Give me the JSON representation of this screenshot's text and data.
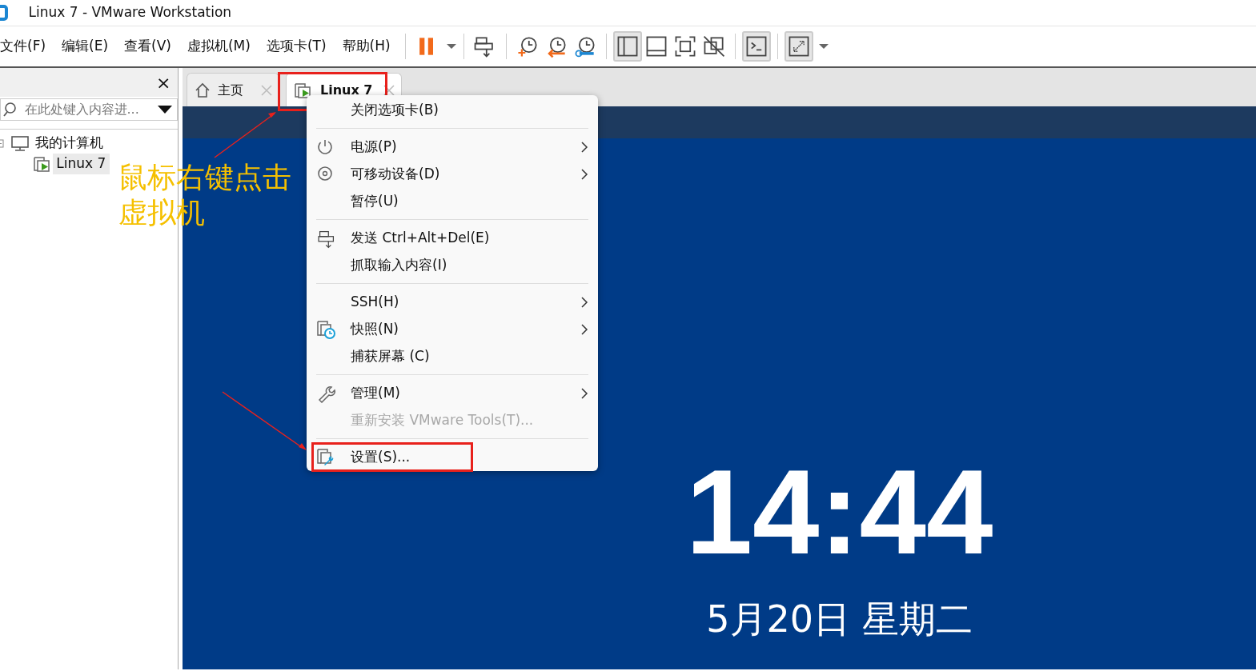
{
  "window": {
    "title": "Linux 7 - VMware Workstation"
  },
  "menubar": [
    "文件(F)",
    "编辑(E)",
    "查看(V)",
    "虚拟机(M)",
    "选项卡(T)",
    "帮助(H)"
  ],
  "toolbar": [
    {
      "kind": "pause",
      "pressed": false
    },
    {
      "kind": "send",
      "pressed": false
    },
    {
      "kind": "snap-take",
      "pressed": false
    },
    {
      "kind": "snap-revert",
      "pressed": false
    },
    {
      "kind": "snap-manage",
      "pressed": false
    },
    {
      "kind": "library",
      "pressed": true
    },
    {
      "kind": "thumbs",
      "pressed": false
    },
    {
      "kind": "fullscreen",
      "pressed": false
    },
    {
      "kind": "unity",
      "pressed": false
    },
    {
      "kind": "console",
      "pressed": true
    },
    {
      "kind": "stretch",
      "pressed": true
    }
  ],
  "sidebar": {
    "close": "×",
    "search": {
      "placeholder": "在此处键入内容进..."
    },
    "tree": [
      {
        "label": "我的计算机",
        "selected": false,
        "children": [
          {
            "label": "Linux 7",
            "selected": true
          }
        ]
      }
    ]
  },
  "tabs": [
    {
      "label": "主页",
      "selected": false
    },
    {
      "label": "Linux 7",
      "selected": true
    }
  ],
  "screen": {
    "time": "14:44",
    "date": "5月20日 星期二"
  },
  "context_menu": [
    {
      "label": "关闭选项卡(B)",
      "submenu": false,
      "disabled": false,
      "separator_after": true
    },
    {
      "label": "电源(P)",
      "submenu": true,
      "disabled": false,
      "separator_after": false
    },
    {
      "label": "可移动设备(D)",
      "submenu": true,
      "disabled": false,
      "separator_after": false
    },
    {
      "label": "暂停(U)",
      "submenu": false,
      "disabled": false,
      "separator_after": true
    },
    {
      "label": "发送 Ctrl+Alt+Del(E)",
      "submenu": false,
      "disabled": false,
      "separator_after": false
    },
    {
      "label": "抓取输入内容(I)",
      "submenu": false,
      "disabled": false,
      "separator_after": true
    },
    {
      "label": "SSH(H)",
      "submenu": true,
      "disabled": false,
      "separator_after": false
    },
    {
      "label": "快照(N)",
      "submenu": true,
      "disabled": false,
      "separator_after": false
    },
    {
      "label": "捕获屏幕 (C)",
      "submenu": false,
      "disabled": false,
      "separator_after": true
    },
    {
      "label": "管理(M)",
      "submenu": true,
      "disabled": false,
      "separator_after": false
    },
    {
      "label": "重新安装 VMware Tools(T)...",
      "submenu": false,
      "disabled": true,
      "separator_after": true
    },
    {
      "label": "设置(S)...",
      "submenu": false,
      "disabled": false,
      "separator_after": false,
      "highlighted": true
    }
  ],
  "annotation": {
    "lines": [
      "鼠标右键点击",
      "虚拟机"
    ]
  }
}
